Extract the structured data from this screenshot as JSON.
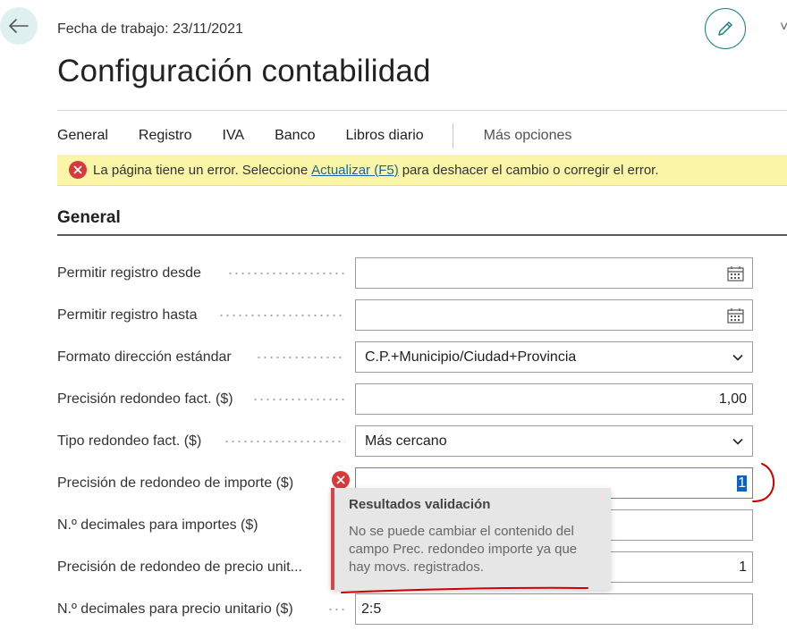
{
  "header": {
    "work_date": "Fecha de trabajo: 23/11/2021",
    "title": "Configuración contabilidad"
  },
  "tabs": [
    {
      "label": "General"
    },
    {
      "label": "Registro"
    },
    {
      "label": "IVA"
    },
    {
      "label": "Banco"
    },
    {
      "label": "Libros diario"
    },
    {
      "label": "Más opciones"
    }
  ],
  "error_banner": {
    "text_before": "La página tiene un error. Seleccione",
    "link": "Actualizar (F5)",
    "text_after": "para deshacer el cambio o corregir el error."
  },
  "section": {
    "title": "General"
  },
  "fields": [
    {
      "label": "Permitir registro desde",
      "value": "",
      "kind": "date"
    },
    {
      "label": "Permitir registro hasta",
      "value": "",
      "kind": "date"
    },
    {
      "label": "Formato dirección estándar",
      "value": "C.P.+Municipio/Ciudad+Provincia",
      "kind": "select"
    },
    {
      "label": "Precisión redondeo fact. ($)",
      "value": "1,00",
      "kind": "number"
    },
    {
      "label": "Tipo redondeo fact. ($)",
      "value": "Más cercano",
      "kind": "select"
    },
    {
      "label": "Precisión de redondeo de importe ($)",
      "value": "1",
      "kind": "number",
      "error": true
    },
    {
      "label": "N.º decimales para importes ($)",
      "value": "",
      "kind": "text"
    },
    {
      "label": "Precisión de redondeo de precio unit...",
      "value": "1",
      "kind": "number"
    },
    {
      "label": "N.º decimales para precio unitario ($)",
      "value": "2:5",
      "kind": "text"
    }
  ],
  "tooltip": {
    "title": "Resultados validación",
    "body": "No se puede cambiar el contenido del campo Prec. redondeo importe ya que hay movs. registrados."
  },
  "icons": {
    "back": "back-arrow-icon",
    "edit": "pencil-icon",
    "calendar": "calendar-icon",
    "dropdown": "chevron-down-icon",
    "error": "error-icon"
  },
  "colors": {
    "accent": "#1f7e85",
    "error": "#d73a3a",
    "banner_bg": "#fbf5a7",
    "link": "#1e63a3",
    "selection": "#0d62c7",
    "annotation": "#d00000"
  }
}
